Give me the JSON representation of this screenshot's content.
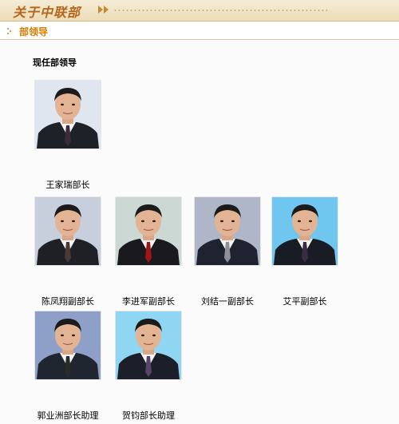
{
  "banner": {
    "title": "关于中联部"
  },
  "section_bar": {
    "title": "部领导"
  },
  "main": {
    "heading": "现任部领导",
    "leaders": [
      {
        "caption": "王家瑞部长",
        "bg": "#dfe6f0",
        "suit": "#1f2128",
        "tie": "#3a2d3a"
      },
      {
        "caption": "陈凤翔副部长",
        "bg": "#c7cfdc",
        "suit": "#1e2026",
        "tie": "#4b3a33"
      },
      {
        "caption": "李进军副部长",
        "bg": "#ccd8d4",
        "suit": "#1a1a1e",
        "tie": "#a01616"
      },
      {
        "caption": "刘结一副部长",
        "bg": "#aeb6c8",
        "suit": "#1f2330",
        "tie": "#8f8f97"
      },
      {
        "caption": "艾平副部长",
        "bg": "#6fc6ee",
        "suit": "#1a1c25",
        "tie": "#3a2c44"
      },
      {
        "caption": "郭业洲部长助理",
        "bg": "#8ea0c8",
        "suit": "#20262f",
        "tie": "#2a2a2a"
      },
      {
        "caption": "贺钧部长助理",
        "bg": "#8fd6f2",
        "suit": "#1c1f2a",
        "tie": "#57446a"
      }
    ]
  }
}
